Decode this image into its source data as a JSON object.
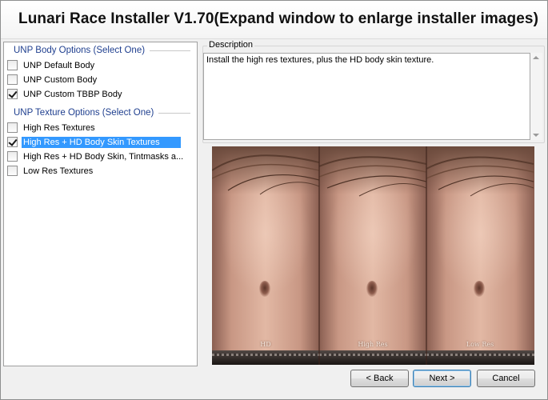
{
  "window": {
    "title": "Lunari Race Installer V1.70(Expand window to enlarge installer images)"
  },
  "groups": [
    {
      "header": "UNP Body Options (Select One)",
      "options": [
        {
          "label": "UNP Default Body",
          "checked": false,
          "selected": false
        },
        {
          "label": "UNP Custom Body",
          "checked": false,
          "selected": false
        },
        {
          "label": "UNP Custom TBBP Body",
          "checked": true,
          "selected": false
        }
      ]
    },
    {
      "header": "UNP Texture Options (Select One)",
      "options": [
        {
          "label": "High Res Textures",
          "checked": false,
          "selected": false
        },
        {
          "label": "High Res + HD Body Skin Textures",
          "checked": true,
          "selected": true
        },
        {
          "label": "High Res + HD Body Skin, Tintmasks a...",
          "checked": false,
          "selected": false
        },
        {
          "label": "Low Res Textures",
          "checked": false,
          "selected": false
        }
      ]
    }
  ],
  "description": {
    "label": "Description",
    "text": "Install the high res textures, plus the HD body skin texture."
  },
  "preview": {
    "panels": [
      "HD",
      "High Res",
      "Low Res"
    ]
  },
  "buttons": {
    "back": "< Back",
    "next": "Next >",
    "cancel": "Cancel"
  }
}
